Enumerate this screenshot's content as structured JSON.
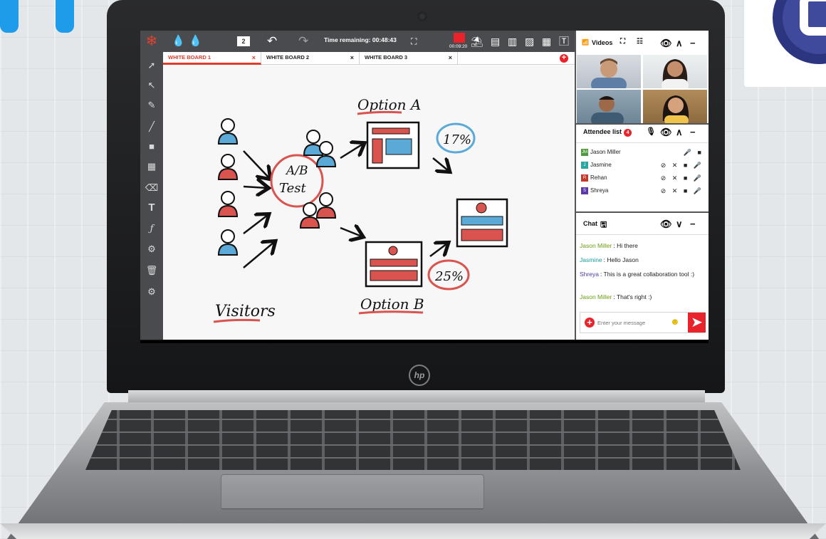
{
  "toolbar": {
    "page_number": "2",
    "time_remaining": "Time remaining: 00:48:43",
    "record_time": "00:09:20",
    "undo_icon": "↶",
    "redo_icon": "↷"
  },
  "tabs": [
    {
      "label": "WHITE BOARD 1",
      "close": "×"
    },
    {
      "label": "WHITE BOARD 2",
      "close": "×"
    },
    {
      "label": "WHITE BOARD 3",
      "close": "×"
    }
  ],
  "add_tab": "+",
  "whiteboard": {
    "option_a": "Option A",
    "option_b": "Option B",
    "ab_test_1": "A/B",
    "ab_test_2": "Test",
    "visitors": "Visitors",
    "pct_a": "17%",
    "pct_b": "25%"
  },
  "videos": {
    "title": "Videos"
  },
  "attendees": {
    "title": "Attendee list",
    "count": "4",
    "items": [
      {
        "initials": "JM",
        "name": "Jason Miller",
        "color": "#4f9a3b",
        "icons": "🎤 ■"
      },
      {
        "initials": "J",
        "name": "Jasmine",
        "color": "#2aa7a0",
        "icons": "⊘ ✕ ■ 🎤"
      },
      {
        "initials": "R",
        "name": "Rehan",
        "color": "#c0392b",
        "icons": "⊘ ✕ ■ 🎤"
      },
      {
        "initials": "S",
        "name": "Shreya",
        "color": "#5b3aa8",
        "icons": "⊘ ✕ ■ 🎤"
      }
    ]
  },
  "chat": {
    "title": "Chat",
    "messages": [
      {
        "name": "Jason Miller",
        "text": "Hi there",
        "color": "#6e9b13"
      },
      {
        "name": "Jasmine",
        "text": "Hello Jason",
        "color": "#1a9b9b"
      },
      {
        "name": "Shreya",
        "text": "This is a great collaboration tool :)",
        "color": "#4a3aa8"
      },
      {
        "name": "Jason Miller",
        "text": "That's right :)",
        "color": "#6e9b13"
      }
    ],
    "input_placeholder": "Enter your message"
  },
  "branding": {
    "laptop_logo": "hp"
  },
  "colors": {
    "accent": "#e8232b",
    "toolbar": "#4a4b4f",
    "sketch_red": "#d9534f",
    "sketch_blue": "#5aa9d6"
  }
}
